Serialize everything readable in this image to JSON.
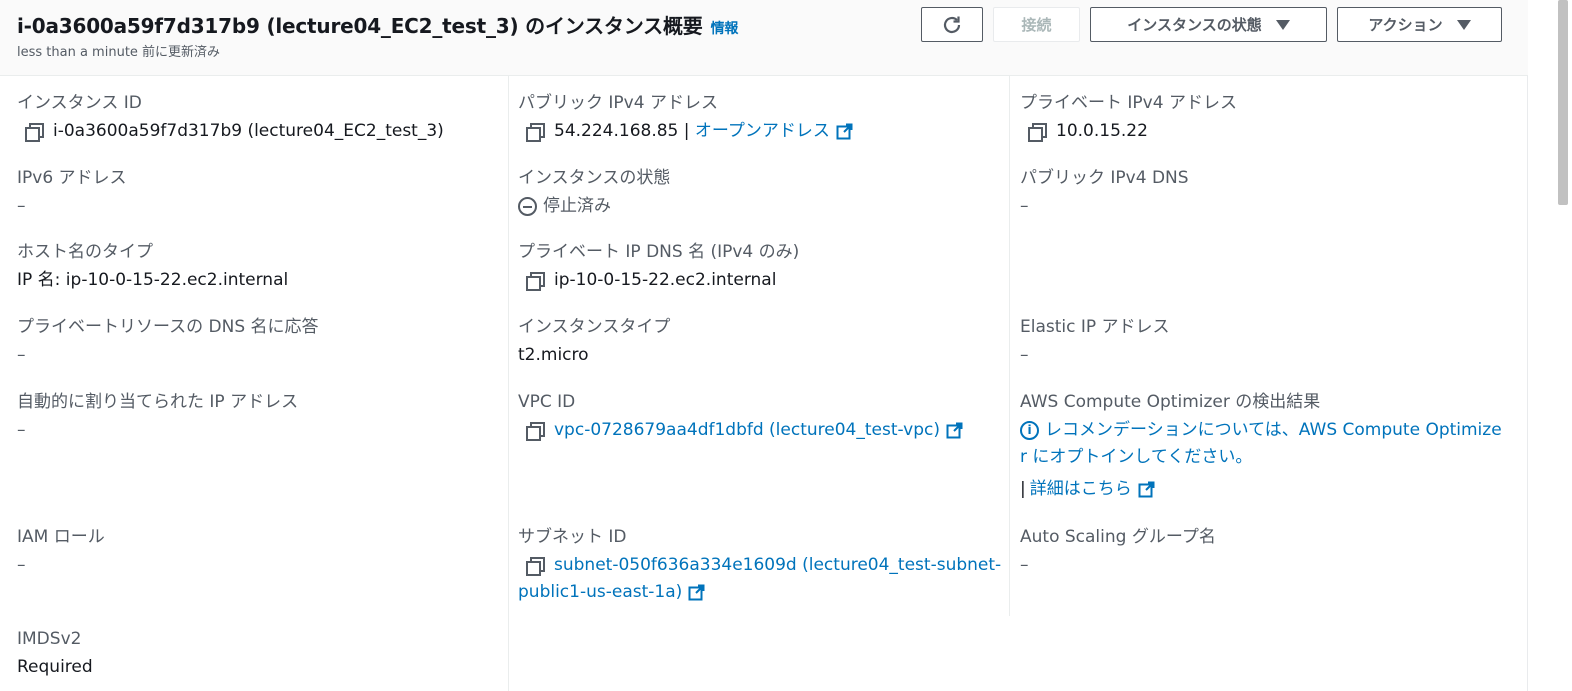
{
  "header": {
    "title": "i-0a3600a59f7d317b9 (lecture04_EC2_test_3) のインスタンス概要",
    "info_link": "情報",
    "subtitle": "less than a minute 前に更新済み",
    "buttons": {
      "connect": "接続",
      "instance_state": "インスタンスの状態",
      "actions": "アクション"
    }
  },
  "column1": {
    "instance_id": {
      "label": "インスタンス ID",
      "value": "i-0a3600a59f7d317b9 (lecture04_EC2_test_3)"
    },
    "ipv6": {
      "label": "IPv6 アドレス",
      "value": "–"
    },
    "hostname_type": {
      "label": "ホスト名のタイプ",
      "value": "IP 名: ip-10-0-15-22.ec2.internal"
    },
    "private_dns_answer": {
      "label": "プライベートリソースの DNS 名に応答",
      "value": "–"
    },
    "auto_ip": {
      "label": "自動的に割り当てられた IP アドレス",
      "value": "–"
    },
    "iam_role": {
      "label": "IAM ロール",
      "value": "–"
    },
    "imdsv2": {
      "label": "IMDSv2",
      "value": "Required"
    }
  },
  "column2": {
    "public_ipv4": {
      "label": "パブリック IPv4 アドレス",
      "value": "54.224.168.85",
      "separator": " | ",
      "link": "オープンアドレス"
    },
    "instance_state": {
      "label": "インスタンスの状態",
      "value": "停止済み"
    },
    "private_ip_dns": {
      "label": "プライベート IP DNS 名 (IPv4 のみ)",
      "value": "ip-10-0-15-22.ec2.internal"
    },
    "instance_type": {
      "label": "インスタンスタイプ",
      "value": "t2.micro"
    },
    "vpc_id": {
      "label": "VPC ID",
      "value": "vpc-0728679aa4df1dbfd (lecture04_test-vpc)"
    },
    "subnet_id": {
      "label": "サブネット ID",
      "value_line1": "subnet-050f636a334e1609d (lecture04_test-subnet-",
      "value_line2": "public1-us-east-1a)"
    }
  },
  "column3": {
    "private_ipv4": {
      "label": "プライベート IPv4 アドレス",
      "value": "10.0.15.22"
    },
    "public_dns": {
      "label": "パブリック IPv4 DNS",
      "value": "–"
    },
    "elastic_ip": {
      "label": "Elastic IP アドレス",
      "value": "–"
    },
    "compute_optimizer": {
      "label": "AWS Compute Optimizer の検出結果",
      "line1": "レコメンデーションについては、AWS Compute Optimize",
      "line2": "r にオプトインしてください。",
      "separator": "|",
      "detail_link": "詳細はこちら"
    },
    "asg": {
      "label": "Auto Scaling グループ名",
      "value": "–"
    }
  },
  "colors": {
    "link": "#0073bb",
    "text": "#16191f",
    "label": "#545b64",
    "border": "#eaeded"
  },
  "icons": [
    "refresh-icon",
    "caret-down-icon",
    "copy-icon",
    "external-link-icon",
    "stopped-icon",
    "info-icon"
  ]
}
